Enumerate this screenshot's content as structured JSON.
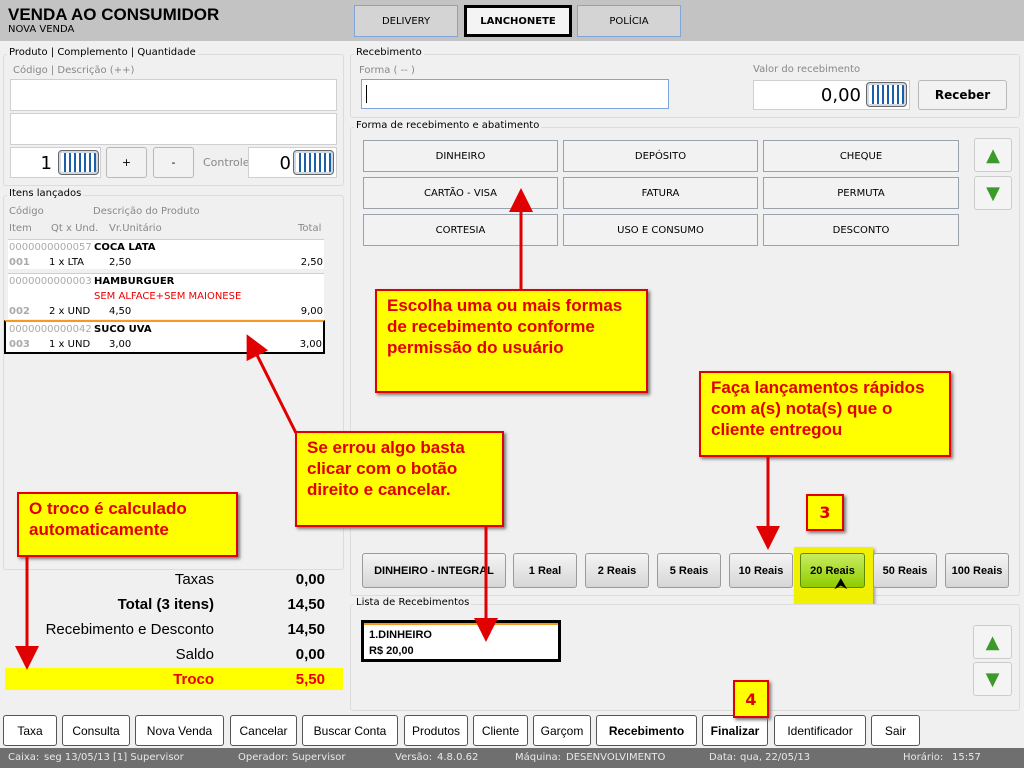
{
  "header": {
    "title": "VENDA AO CONSUMIDOR",
    "subtitle": "NOVA VENDA",
    "tabs": [
      {
        "label": "DELIVERY"
      },
      {
        "label": "LANCHONETE"
      },
      {
        "label": "POLÍCIA"
      }
    ]
  },
  "produto": {
    "group": "Produto | Complemento | Quantidade",
    "code_label": "Código | Descrição (++)",
    "qty": "1",
    "plus": "+",
    "minus": "-",
    "controle_label": "Controle",
    "controle": "0"
  },
  "itens": {
    "group": "Itens lançados",
    "h_codigo": "Código",
    "h_desc": "Descrição do Produto",
    "h_item": "Item",
    "h_qt": "Qt x Und.",
    "h_vu": "Vr.Unitário",
    "h_total": "Total",
    "rows": [
      {
        "code": "0000000000057",
        "name": "COCA LATA",
        "note": "",
        "item": "001",
        "qt": "1 x LTA",
        "vu": "2,50",
        "total": "2,50"
      },
      {
        "code": "0000000000003",
        "name": "HAMBURGUER",
        "note": "SEM ALFACE+SEM MAIONESE",
        "item": "002",
        "qt": "2 x UND",
        "vu": "4,50",
        "total": "9,00"
      },
      {
        "code": "0000000000042",
        "name": "SUCO UVA",
        "note": "",
        "item": "003",
        "qt": "1 x UND",
        "vu": "3,00",
        "total": "3,00"
      }
    ]
  },
  "totais": {
    "taxas_label": "Taxas",
    "taxas": "0,00",
    "total_label": "Total (3 itens)",
    "total": "14,50",
    "receb_label": "Recebimento e Desconto",
    "receb": "14,50",
    "saldo_label": "Saldo",
    "saldo": "0,00",
    "troco_label": "Troco",
    "troco": "5,50"
  },
  "recebimento": {
    "group": "Recebimento",
    "forma_label": "Forma ( -- )",
    "valor_label": "Valor do recebimento",
    "valor": "0,00",
    "receber": "Receber"
  },
  "formas": {
    "group": "Forma de recebimento e abatimento",
    "buttons": [
      "DINHEIRO",
      "DEPÓSITO",
      "CHEQUE",
      "CARTÃO - VISA",
      "FATURA",
      "PERMUTA",
      "CORTESIA",
      "USO E CONSUMO",
      "DESCONTO"
    ]
  },
  "quick": [
    "DINHEIRO - INTEGRAL",
    "1 Real",
    "2 Reais",
    "5 Reais",
    "10 Reais",
    "20 Reais",
    "50 Reais",
    "100 Reais"
  ],
  "lista": {
    "group": "Lista de Recebimentos",
    "line1": "1.DINHEIRO",
    "line2": "R$ 20,00"
  },
  "bottom": [
    "Taxa",
    "Consulta",
    "Nova Venda",
    "Cancelar",
    "Buscar Conta",
    "Produtos",
    "Cliente",
    "Garçom",
    "Recebimento",
    "Finalizar",
    "Identificador",
    "Sair"
  ],
  "status": {
    "caixa_l": "Caixa:",
    "caixa": "seg 13/05/13 [1] Supervisor",
    "oper_l": "Operador:",
    "oper": "Supervisor",
    "ver_l": "Versão:",
    "ver": "4.8.0.62",
    "maq_l": "Máquina:",
    "maq": "DESENVOLVIMENTO",
    "data_l": "Data:",
    "data": "qua, 22/05/13",
    "hora_l": "Horário:",
    "hora": "15:57"
  },
  "callouts": {
    "formas": "Escolha uma ou mais formas de recebimento conforme permissão do usuário",
    "rapidos": "Faça lançamentos rápidos com a(s) nota(s) que o cliente entregou",
    "errou": "Se errou algo basta clicar com o botão direito e cancelar.",
    "troco": "O troco é calculado automaticamente",
    "step3": "3",
    "step4": "4"
  },
  "colors": {
    "callout_bg": "#ffff00",
    "callout_border": "#e00000",
    "troco_bg": "#ffff00",
    "highlight_green": "#a8d800"
  }
}
